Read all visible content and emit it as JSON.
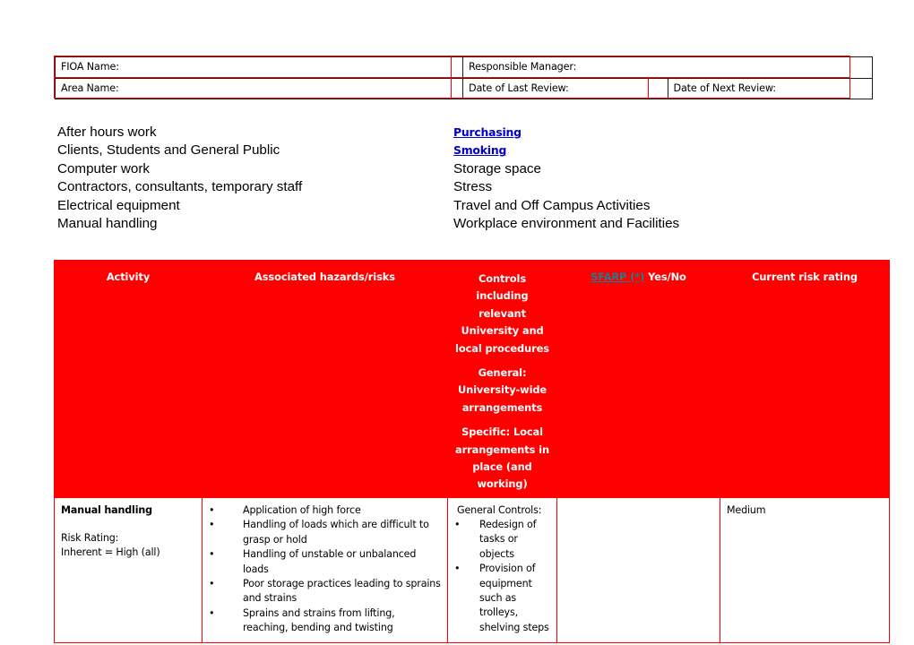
{
  "info_table": {
    "rows": [
      [
        {
          "label": "FIOA Name:",
          "value": ""
        },
        {
          "label": "Responsible Manager:",
          "value": ""
        }
      ],
      [
        {
          "label": "Area Name:",
          "value": ""
        },
        {
          "label": "Date of Last Review:",
          "value": ""
        },
        {
          "label": "Date of Next Review:",
          "value": ""
        }
      ]
    ]
  },
  "topics": {
    "left_column": [
      {
        "label": "After hours work",
        "is_link": false
      },
      {
        "label": "Clients, Students and General Public",
        "is_link": false
      },
      {
        "label": "Computer work",
        "is_link": false
      },
      {
        "label": "Contractors, consultants, temporary staff",
        "is_link": false
      },
      {
        "label": "Electrical equipment",
        "is_link": false
      },
      {
        "label": "Manual handling",
        "is_link": false
      }
    ],
    "right_column": [
      {
        "label": "Purchasing",
        "is_link": true
      },
      {
        "label": "Smoking",
        "is_link": true
      },
      {
        "label": "Storage space",
        "is_link": false
      },
      {
        "label": "Stress",
        "is_link": false
      },
      {
        "label": "Travel and Off Campus Activities",
        "is_link": false
      },
      {
        "label": "Workplace environment and Facilities",
        "is_link": false
      }
    ]
  },
  "risk_table": {
    "headers": {
      "activity": "Activity",
      "hazards": "Associated hazards/risks",
      "controls_paragraphs": [
        "Controls including relevant University and local procedures",
        "General: University-wide arrangements",
        "Specific: Local arrangements in place (and working)"
      ],
      "sfarp_link": "SFARP (*)",
      "sfarp_rest": " Yes/No",
      "current_risk_rating": "Current risk rating"
    },
    "rows": [
      {
        "activity_title": "Manual handling",
        "activity_lines": [
          "Risk Rating:",
          "Inherent = High (all)"
        ],
        "hazards": [
          "Application of high force",
          "Handling of loads which are difficult to grasp or hold",
          "Handling of unstable or unbalanced loads",
          "Poor storage practices leading to sprains and strains",
          "Sprains and strains from lifting, reaching, bending and twisting"
        ],
        "controls_intro": "General Controls:",
        "controls": [
          "Redesign of tasks or objects",
          "Provision of equipment such as trolleys, shelving steps"
        ],
        "sfarp": "",
        "rating": "Medium"
      }
    ]
  },
  "colors": {
    "table_red": "#FF0000",
    "link_blue": "#0000CC",
    "sfarp_link_teal": "#1F7C8C",
    "header_text": "#FFFFFF",
    "body_text": "#000000"
  }
}
